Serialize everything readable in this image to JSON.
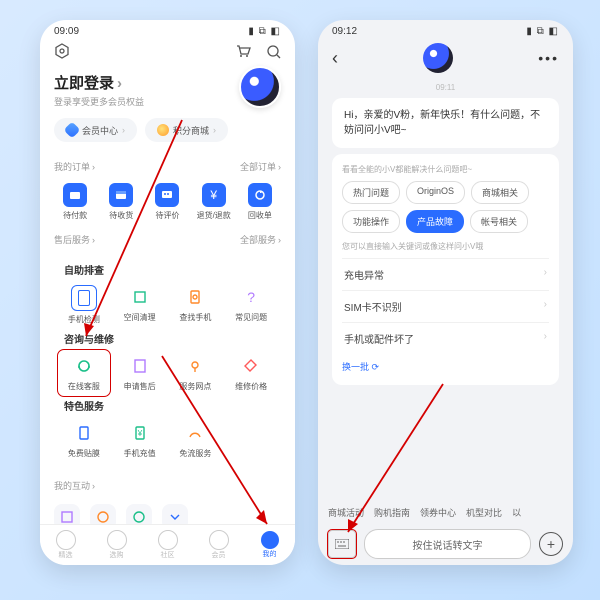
{
  "left": {
    "status_time": "09:09",
    "status_r": "▮ ⧉ ◧",
    "login_title": "立即登录",
    "login_sub": "登录享受更多会员权益",
    "pill1": "会员中心",
    "pill2": "积分商城",
    "orders_h": "我的订单",
    "orders_more": "全部订单",
    "orders": [
      "待付款",
      "待收货",
      "待评价",
      "退货/退款",
      "回收单"
    ],
    "after_h": "售后服务",
    "after_more": "全部服务",
    "selfgrp": "自助排查",
    "self": [
      "手机检测",
      "空间清理",
      "查找手机",
      "常见问题"
    ],
    "repgrp": "咨询与维修",
    "rep": [
      "在线客服",
      "申请售后",
      "服务网点",
      "维修价格"
    ],
    "spgrp": "特色服务",
    "sp": [
      "免费贴膜",
      "手机充值",
      "免流服务"
    ],
    "inter_h": "我的互动",
    "tabs": [
      "精选",
      "选购",
      "社区",
      "会员",
      "我的"
    ]
  },
  "right": {
    "status_time": "09:12",
    "status_r": "▮ ⧉ ◧",
    "ts": "09:11",
    "greet": "Hi，亲爱的V粉，新年快乐！有什么问题，不妨问问小V吧~",
    "card_tip": "看看全能的小V都能解决什么问题吧~",
    "chips": [
      "热门问题",
      "OriginOS",
      "商城相关",
      "功能操作",
      "产品故障",
      "帐号相关"
    ],
    "chip_active": 4,
    "list_tip": "您可以直接输入关键词或像这样问小V哦",
    "items": [
      "充电异常",
      "SIM卡不识别",
      "手机或配件坏了"
    ],
    "refresh": "换一批",
    "bottom_chips": [
      "商城活动",
      "购机指南",
      "领券中心",
      "机型对比",
      "以"
    ],
    "voice": "按住说话转文字"
  }
}
